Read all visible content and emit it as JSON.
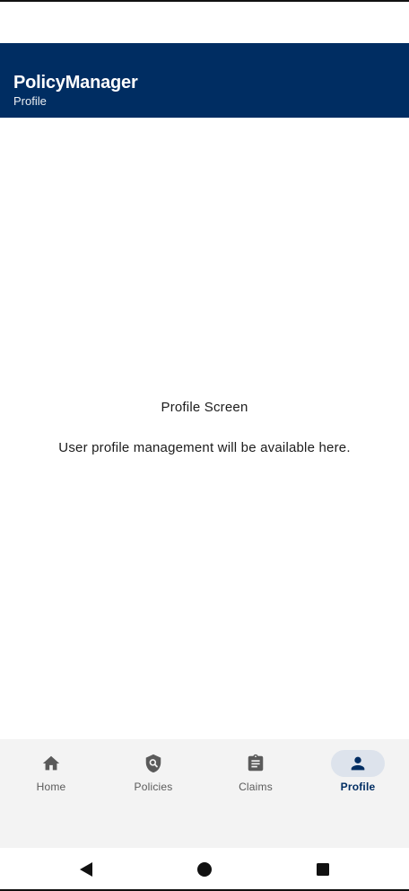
{
  "app_bar": {
    "title": "PolicyManager",
    "subtitle": "Profile",
    "background": "#002d62"
  },
  "content": {
    "heading": "Profile Screen",
    "description": "User profile management will be available here."
  },
  "bottom_nav": {
    "active": "Profile",
    "accent_color": "#002d62",
    "items": [
      {
        "label": "Home",
        "icon": "home-icon"
      },
      {
        "label": "Policies",
        "icon": "policy-shield-icon"
      },
      {
        "label": "Claims",
        "icon": "clipboard-icon"
      },
      {
        "label": "Profile",
        "icon": "person-icon"
      }
    ]
  },
  "system_nav": {
    "icons": [
      "back-triangle-icon",
      "home-circle-icon",
      "recents-square-icon"
    ]
  }
}
